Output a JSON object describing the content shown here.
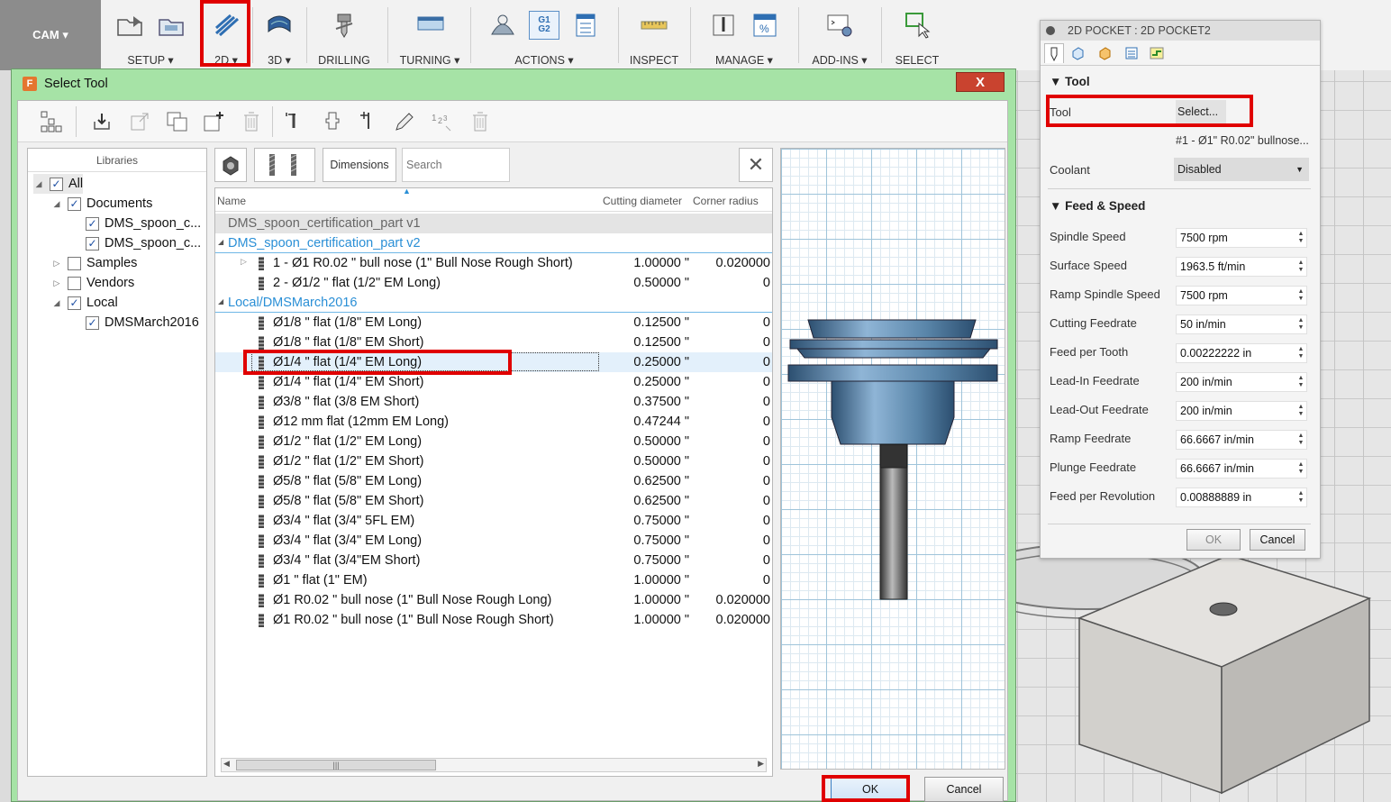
{
  "toolbar": {
    "workspace": "CAM ▾",
    "groups": [
      {
        "label": "SETUP ▾"
      },
      {
        "label": "2D ▾"
      },
      {
        "label": "3D ▾"
      },
      {
        "label": "DRILLING"
      },
      {
        "label": "TURNING ▾"
      },
      {
        "label": "ACTIONS ▾"
      },
      {
        "label": "INSPECT"
      },
      {
        "label": "MANAGE ▾"
      },
      {
        "label": "ADD-INS ▾"
      },
      {
        "label": "SELECT"
      }
    ],
    "g1g2_text": "G1\nG2"
  },
  "dialog": {
    "title": "Select Tool",
    "logo": "F",
    "close": "X",
    "libraries": {
      "header": "Libraries",
      "items": [
        {
          "label": "All",
          "checked": true
        },
        {
          "label": "Documents",
          "checked": true
        },
        {
          "label": "DMS_spoon_c...",
          "checked": true
        },
        {
          "label": "DMS_spoon_c...",
          "checked": true
        },
        {
          "label": "Samples",
          "checked": false
        },
        {
          "label": "Vendors",
          "checked": false
        },
        {
          "label": "Local",
          "checked": true
        },
        {
          "label": "DMSMarch2016",
          "checked": true
        }
      ]
    },
    "filters": {
      "dimensions": "Dimensions",
      "search_placeholder": "Search"
    },
    "columns": {
      "name": "Name",
      "diameter": "Cutting diameter",
      "corner": "Corner radius"
    },
    "groups": [
      "DMS_spoon_certification_part v1",
      "DMS_spoon_certification_part v2",
      "Local/DMSMarch2016"
    ],
    "tools_v2": [
      {
        "name": "1 - Ø1 R0.02 \" bull nose (1\" Bull Nose Rough Short)",
        "diameter": "1.00000 \"",
        "corner": "0.020000"
      },
      {
        "name": "2 - Ø1/2 \" flat (1/2\" EM Long)",
        "diameter": "0.50000 \"",
        "corner": "0"
      }
    ],
    "tools_local": [
      {
        "name": "Ø1/8 \" flat (1/8\" EM Long)",
        "diameter": "0.12500 \"",
        "corner": "0"
      },
      {
        "name": "Ø1/8 \" flat (1/8\" EM Short)",
        "diameter": "0.12500 \"",
        "corner": "0"
      },
      {
        "name": "Ø1/4 \" flat (1/4\" EM Long)",
        "diameter": "0.25000 \"",
        "corner": "0"
      },
      {
        "name": "Ø1/4 \" flat (1/4\" EM Short)",
        "diameter": "0.25000 \"",
        "corner": "0"
      },
      {
        "name": "Ø3/8 \" flat (3/8 EM Short)",
        "diameter": "0.37500 \"",
        "corner": "0"
      },
      {
        "name": "Ø12 mm flat (12mm EM Long)",
        "diameter": "0.47244 \"",
        "corner": "0"
      },
      {
        "name": "Ø1/2 \" flat (1/2\" EM Long)",
        "diameter": "0.50000 \"",
        "corner": "0"
      },
      {
        "name": "Ø1/2 \" flat (1/2\" EM Short)",
        "diameter": "0.50000 \"",
        "corner": "0"
      },
      {
        "name": "Ø5/8 \" flat (5/8\" EM Long)",
        "diameter": "0.62500 \"",
        "corner": "0"
      },
      {
        "name": "Ø5/8 \" flat (5/8\" EM Short)",
        "diameter": "0.62500 \"",
        "corner": "0"
      },
      {
        "name": "Ø3/4 \" flat (3/4\" 5FL EM)",
        "diameter": "0.75000 \"",
        "corner": "0"
      },
      {
        "name": "Ø3/4 \" flat (3/4\" EM Long)",
        "diameter": "0.75000 \"",
        "corner": "0"
      },
      {
        "name": "Ø3/4 \" flat (3/4\"EM Short)",
        "diameter": "0.75000 \"",
        "corner": "0"
      },
      {
        "name": "Ø1 \" flat (1\" EM)",
        "diameter": "1.00000 \"",
        "corner": "0"
      },
      {
        "name": "Ø1 R0.02 \" bull nose (1\" Bull Nose Rough Long)",
        "diameter": "1.00000 \"",
        "corner": "0.020000"
      },
      {
        "name": "Ø1 R0.02 \" bull nose (1\" Bull Nose Rough Short)",
        "diameter": "1.00000 \"",
        "corner": "0.020000"
      }
    ],
    "selected_tool": "Ø1/4 \" flat (1/4\" EM Long)",
    "ok": "OK",
    "cancel": "Cancel"
  },
  "pocket": {
    "title": "2D POCKET : 2D POCKET2",
    "tool_section": "Tool",
    "tool_label": "Tool",
    "tool_button": "Select...",
    "tool_current": "#1 - Ø1\" R0.02\" bullnose...",
    "coolant_label": "Coolant",
    "coolant_value": "Disabled",
    "feed_section": "Feed & Speed",
    "fields": [
      {
        "label": "Spindle Speed",
        "value": "7500 rpm"
      },
      {
        "label": "Surface Speed",
        "value": "1963.5 ft/min"
      },
      {
        "label": "Ramp Spindle Speed",
        "value": "7500 rpm"
      },
      {
        "label": "Cutting Feedrate",
        "value": "50 in/min"
      },
      {
        "label": "Feed per Tooth",
        "value": "0.00222222 in"
      },
      {
        "label": "Lead-In Feedrate",
        "value": "200 in/min"
      },
      {
        "label": "Lead-Out Feedrate",
        "value": "200 in/min"
      },
      {
        "label": "Ramp Feedrate",
        "value": "66.6667 in/min"
      },
      {
        "label": "Plunge Feedrate",
        "value": "66.6667 in/min"
      },
      {
        "label": "Feed per Revolution",
        "value": "0.00888889 in"
      }
    ],
    "ok": "OK",
    "cancel": "Cancel"
  },
  "colors": {
    "highlight": "#e00000",
    "dialog_frame": "#a6e3a6",
    "group_text": "#2a8fd6",
    "tool_body": "#5a86aa"
  }
}
